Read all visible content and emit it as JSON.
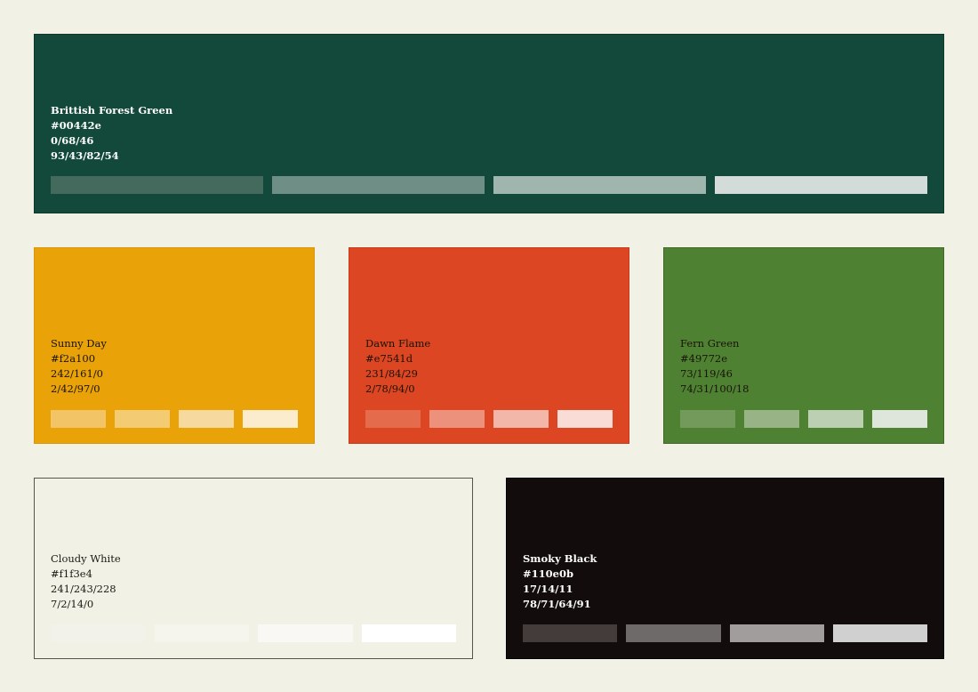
{
  "swatches": [
    {
      "key": "forest",
      "name": "Brittish Forest Green",
      "hex": "#00442e",
      "rgb": "0/68/46",
      "cmyk": "93/43/82/54",
      "fill": "#12493b",
      "tints": [
        "#446a5e",
        "#6f8e85",
        "#9fb5ae",
        "#d4dcd9"
      ]
    },
    {
      "key": "sunny",
      "name": "Sunny Day",
      "hex": "#f2a100",
      "rgb": "242/161/0",
      "cmyk": "2/42/97/0",
      "fill": "#e9a308",
      "tints": [
        "#f2c466",
        "#f2cb73",
        "#f6d99e",
        "#fbeccd"
      ]
    },
    {
      "key": "dawn",
      "name": "Dawn Flame",
      "hex": "#e7541d",
      "rgb": "231/84/29",
      "cmyk": "2/78/94/0",
      "fill": "#dc4622",
      "tints": [
        "#e46b4c",
        "#eb917c",
        "#f2b7a9",
        "#f9dcd5"
      ]
    },
    {
      "key": "fern",
      "name": "Fern Green",
      "hex": "#49772e",
      "rgb": "73/119/46",
      "cmyk": "74/31/100/18",
      "fill": "#4e8232",
      "tints": [
        "#749a5b",
        "#98b487",
        "#bdcfb3",
        "#dee6db"
      ]
    },
    {
      "key": "cloudy",
      "name": "Cloudy White",
      "hex": "#f1f3e4",
      "rgb": "241/243/228",
      "cmyk": "7/2/14/0",
      "fill": "#f2f1e6",
      "tints": [
        "#f3f2ea",
        "#f5f5ee",
        "#f9f8f4",
        "#ffffff"
      ]
    },
    {
      "key": "smoky",
      "name": "Smoky Black",
      "hex": "#110e0b",
      "rgb": "17/14/11",
      "cmyk": "78/71/64/91",
      "fill": "#120d0c",
      "tints": [
        "#433c3b",
        "#6e6a69",
        "#a09d9c",
        "#d1d0d0"
      ]
    }
  ]
}
